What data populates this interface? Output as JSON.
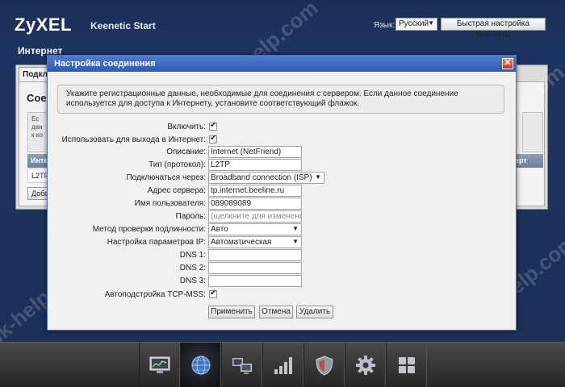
{
  "header": {
    "logo": "ZyXEL",
    "product": "Keenetic Start",
    "language_label": "Язык:",
    "language_value": "Русский",
    "quick_setup_button": "Быстрая настройка NetFriend",
    "page_title": "Интернет"
  },
  "background_panel": {
    "tab_label": "Подкл",
    "heading": "Сое",
    "note_text": "Ес\nдан\nк ко",
    "table_header_left": "Инте",
    "table_header_right": "ерт",
    "table_cell": "L2TF",
    "add_button": "Доба"
  },
  "dialog": {
    "title": "Настройка соединения",
    "close_icon": "close-icon",
    "info_text": "Укажите регистрационные данные, необходимые для соединения с сервером. Если данное соединение используется для доступа к Интернету, установите соответствующий флажок.",
    "fields": {
      "enable": {
        "label": "Включить:",
        "checked": true
      },
      "use_for_internet": {
        "label": "Использовать для выхода в Интернет:",
        "checked": true
      },
      "description": {
        "label": "Описание:",
        "value": "Internet (NetFriend)"
      },
      "protocol": {
        "label": "Тип (протокол):",
        "value": "L2TP"
      },
      "connect_via": {
        "label": "Подключаться через:",
        "value": "Broadband connection (ISP)"
      },
      "server_address": {
        "label": "Адрес сервера:",
        "value": "tp.internet.beeline.ru"
      },
      "username": {
        "label": "Имя пользователя:",
        "value": "089089089"
      },
      "password": {
        "label": "Пароль:",
        "placeholder": "(щелкните для изменения)"
      },
      "auth_method": {
        "label": "Метод проверки подлинности:",
        "value": "Авто"
      },
      "ip_settings": {
        "label": "Настройка параметров IP:",
        "value": "Автоматическая"
      },
      "dns1": {
        "label": "DNS 1:",
        "value": ""
      },
      "dns2": {
        "label": "DNS 2:",
        "value": ""
      },
      "dns3": {
        "label": "DNS 3:",
        "value": ""
      },
      "tcp_mss": {
        "label": "Автоподстройка TCP-MSS:",
        "checked": true
      }
    },
    "buttons": {
      "apply": "Применить",
      "cancel": "Отмена",
      "delete": "Удалить"
    }
  },
  "dock": {
    "items": [
      {
        "icon": "monitor-graph-icon",
        "active": false
      },
      {
        "icon": "globe-icon",
        "active": true
      },
      {
        "icon": "network-computers-icon",
        "active": false
      },
      {
        "icon": "signal-bars-icon",
        "active": false
      },
      {
        "icon": "shield-icon",
        "active": false
      },
      {
        "icon": "gear-icon",
        "active": false
      },
      {
        "icon": "grid-icon",
        "active": false
      }
    ]
  },
  "watermark": "pk-help.com",
  "colors": {
    "background": "#1e3460",
    "dialog_title_bar": "#3a66c0",
    "close_button": "#d9472b",
    "dock": "#333333"
  }
}
